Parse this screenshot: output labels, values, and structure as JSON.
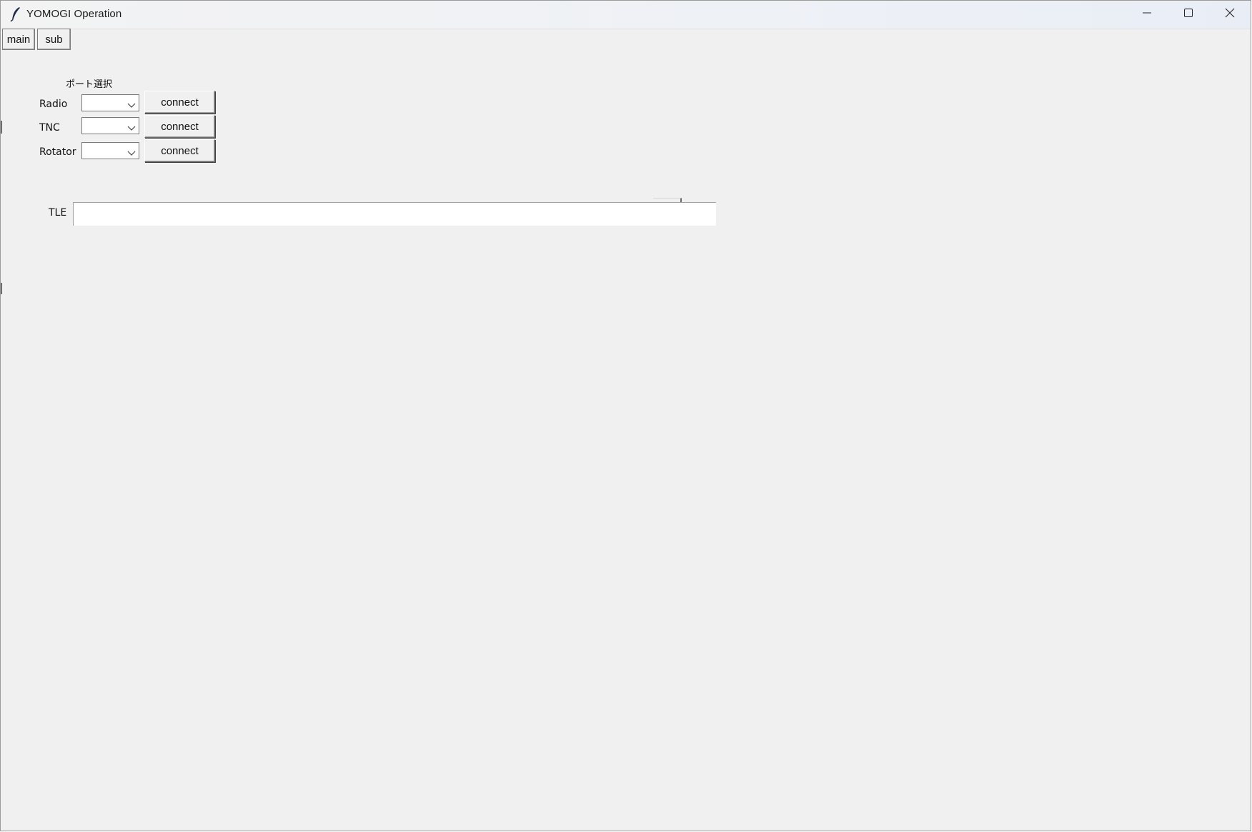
{
  "window": {
    "title": "YOMOGI Operation",
    "icon": "feather-icon",
    "controls": [
      "minimize-icon",
      "maximize-icon",
      "close-icon"
    ]
  },
  "tabs": [
    {
      "label": "main",
      "selected": false
    },
    {
      "label": "sub",
      "selected": false
    }
  ],
  "port_selection": {
    "title": "ポート選択",
    "rows": [
      {
        "label": "Radio",
        "selected_value": "",
        "button_label": "connect"
      },
      {
        "label": "TNC",
        "selected_value": "",
        "button_label": "connect"
      },
      {
        "label": "Rotator",
        "selected_value": "",
        "button_label": "connect"
      }
    ]
  },
  "tle": {
    "label": "TLE",
    "value": ""
  },
  "colors": {
    "window_bg": "#f0f0f0",
    "title_bar": "#eef1f6",
    "input_bg": "#ffffff"
  }
}
